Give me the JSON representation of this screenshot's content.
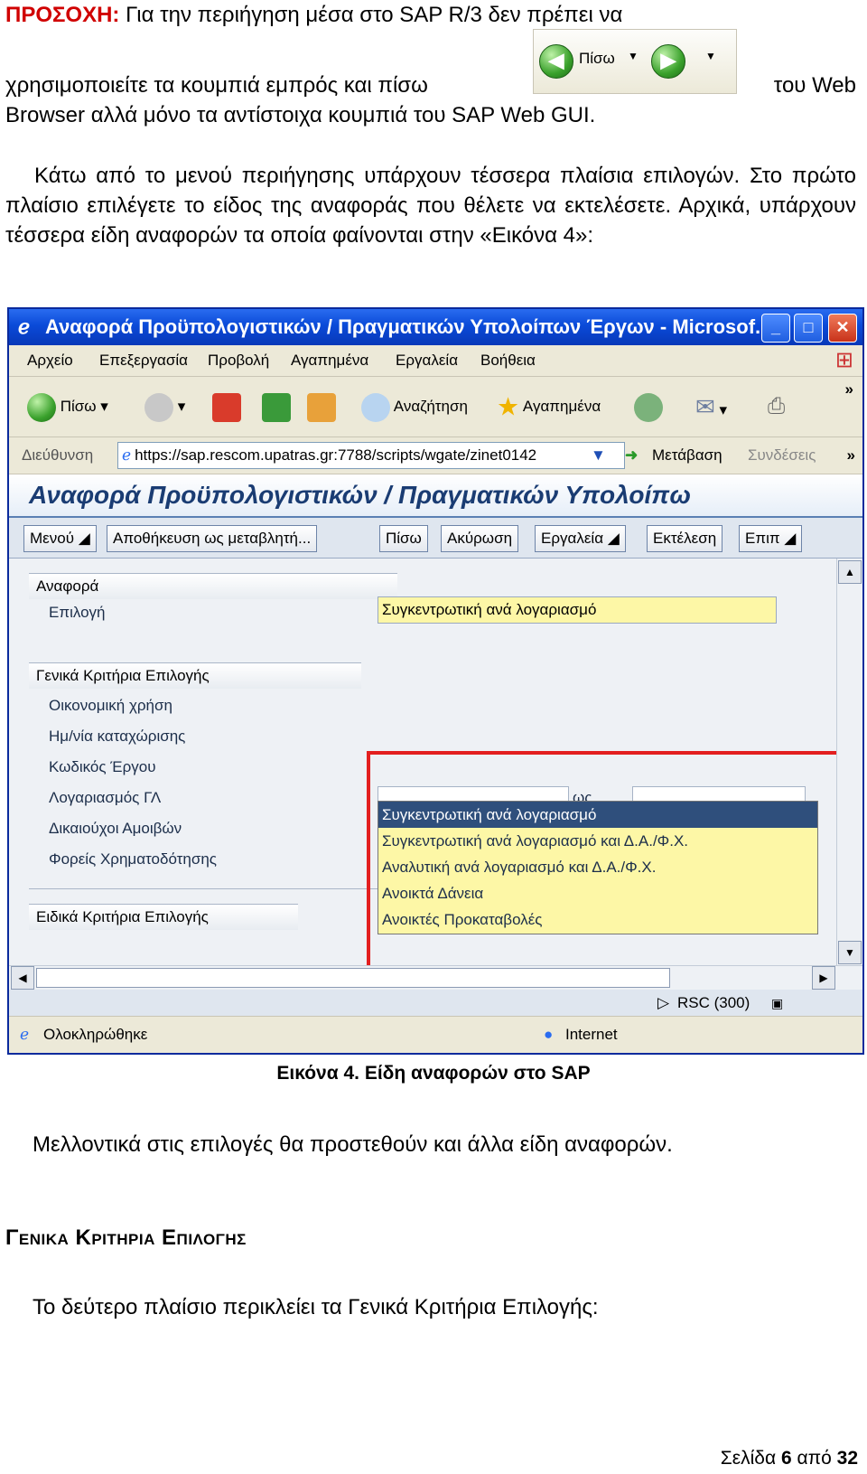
{
  "para1": {
    "warning_label": "ΠΡΟΣΟΧΗ:",
    "line1": "Για την περιήγηση μέσα στο SAP R/3 δεν πρέπει να",
    "line2_start": "χρησιμοποιείτε τα κουμπιά εμπρός και πίσω",
    "line2_end": "του Web",
    "line3": "Browser αλλά μόνο τα αντίστοιχα κουμπιά του SAP Web GUI.",
    "nav_back_label": "Πίσω"
  },
  "para2": "Κάτω από το μενού περιήγησης υπάρχουν τέσσερα πλαίσια επιλογών. Στο πρώτο πλαίσιο επιλέγετε το είδος της αναφοράς που θέλετε να εκτελέσετε. Αρχικά, υπάρχουν τέσσερα είδη αναφορών τα οποία φαίνονται στην «Εικόνα 4»:",
  "window": {
    "title": "Αναφορά Προϋπολογιστικών / Πραγματικών Υπολοίπων Έργων - Microsof...",
    "menu": [
      "Αρχείο",
      "Επεξεργασία",
      "Προβολή",
      "Αγαπημένα",
      "Εργαλεία",
      "Βοήθεια"
    ],
    "toolbar": {
      "back": "Πίσω",
      "search": "Αναζήτηση",
      "favorites": "Αγαπημένα",
      "more": "»"
    },
    "address": {
      "label": "Διεύθυνση",
      "url": "https://sap.rescom.upatras.gr:7788/scripts/wgate/zinet0142",
      "go": "Μετάβαση",
      "links": "Συνδέσεις",
      "more": "»"
    },
    "status_left": "Ολοκληρώθηκε",
    "status_zone": "Internet"
  },
  "sap": {
    "title": "Αναφορά Προϋπολογιστικών / Πραγματικών Υπολοίπω",
    "buttons": [
      "Μενού",
      "Αποθήκευση ως μεταβλητή...",
      "Πίσω",
      "Ακύρωση",
      "Εργαλεία",
      "Εκτέλεση",
      "Επιπ"
    ],
    "group1": "Αναφορά",
    "selection_label": "Επιλογή",
    "selection_value": "Συγκεντρωτική ανά λογαριασμό",
    "options": [
      "Συγκεντρωτική ανά λογαριασμό",
      "Συγκεντρωτική ανά λογαριασμό και Δ.Α./Φ.Χ.",
      "Αναλυτική ανά λογαριασμό και Δ.Α./Φ.Χ.",
      "Ανοικτά Δάνεια",
      "Ανοικτές Προκαταβολές"
    ],
    "group2": "Γενικά Κριτήρια Επιλογής",
    "criteria": [
      "Οικονομική χρήση",
      "Ημ/νία καταχώρισης",
      "Κωδικός Έργου",
      "Λογαριασμός ΓΛ",
      "Δικαιούχοι Αμοιβών",
      "Φορείς Χρηματοδότησης"
    ],
    "to_label": "ως",
    "group3": "Ειδικά Κριτήρια Επιλογής",
    "system": "RSC (300)"
  },
  "caption": "Εικόνα 4. Είδη αναφορών στο SAP",
  "para3": "Μελλοντικά στις επιλογές θα προστεθούν και άλλα είδη αναφορών.",
  "heading": "Γενικα Κριτηρια Επιλογης",
  "para4": "Το δεύτερο πλαίσιο περικλείει τα Γενικά Κριτήρια Επιλογής:",
  "footer": {
    "prefix": "Σελίδα",
    "page": "6",
    "sep": "από",
    "total": "32"
  }
}
